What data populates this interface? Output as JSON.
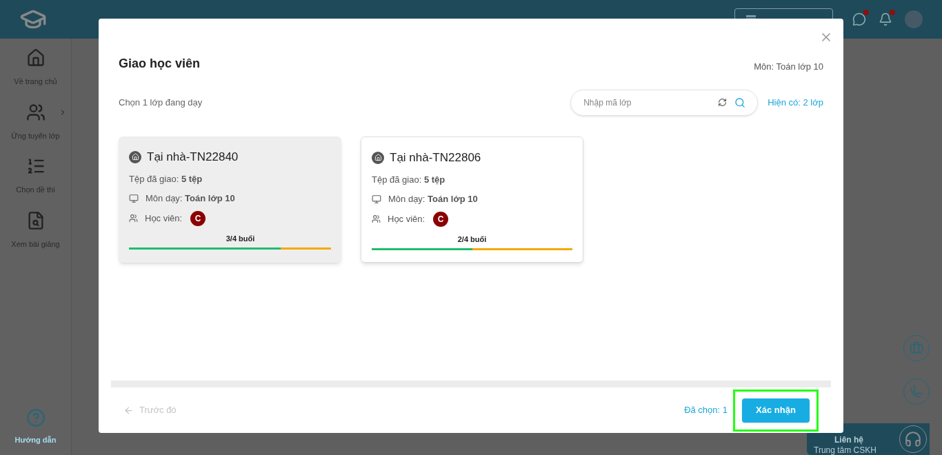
{
  "header": {
    "chat_unread": true,
    "bell_unread": true
  },
  "sidebar": {
    "items": [
      {
        "label": "Về trang chủ",
        "kind": "home",
        "has_submenu": false
      },
      {
        "label": "Ứng tuyển lớp",
        "kind": "group",
        "has_submenu": true
      },
      {
        "label": "Chọn đề thi",
        "kind": "list",
        "has_submenu": false
      },
      {
        "label": "Xem bài giảng",
        "kind": "doc",
        "has_submenu": false
      }
    ],
    "help": "Hướng dẫn"
  },
  "contact": {
    "title": "Liên hệ",
    "subtitle": "Trung tâm CSKH"
  },
  "modal": {
    "title": "Giao học viên",
    "subject": "Môn: Toán lớp 10",
    "prompt": "Chọn 1 lớp đang dạy",
    "search": {
      "placeholder": "Nhập mã lớp"
    },
    "available": "Hiện có: 2 lớp",
    "classes": [
      {
        "name": "Tại nhà-TN22840",
        "files_label": "Tệp đã giao:",
        "files": "5 tệp",
        "subject_label": "Môn dạy:",
        "subject": "Toán lớp 10",
        "students_label": "Học viên:",
        "students": [
          "C"
        ],
        "sessions": "3/4 buổi",
        "level": 0.75,
        "selected": true
      },
      {
        "name": "Tại nhà-TN22806",
        "files_label": "Tệp đã giao:",
        "files": "5 tệp",
        "subject_label": "Môn dạy:",
        "subject": "Toán lớp 10",
        "students_label": "Học viên:",
        "students": [
          "C"
        ],
        "sessions": "2/4 buổi",
        "level": 0.5,
        "selected": false
      }
    ],
    "back": {
      "label": "Trước đó",
      "disabled": true
    },
    "chosen": "Đã chọn: 1",
    "confirm": {
      "label": "Xác nhận",
      "highlighted": true
    }
  }
}
